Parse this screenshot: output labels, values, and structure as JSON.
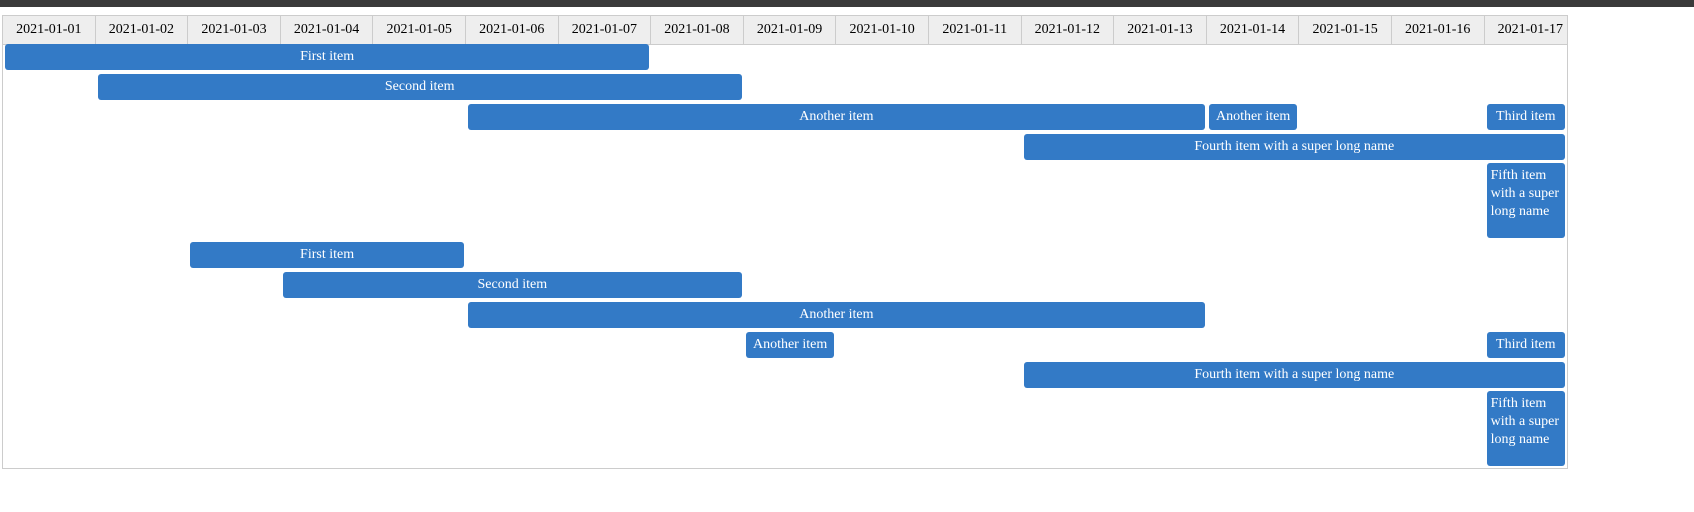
{
  "dates": [
    "2021-01-01",
    "2021-01-02",
    "2021-01-03",
    "2021-01-04",
    "2021-01-05",
    "2021-01-06",
    "2021-01-07",
    "2021-01-08",
    "2021-01-09",
    "2021-01-10",
    "2021-01-11",
    "2021-01-12",
    "2021-01-13",
    "2021-01-14",
    "2021-01-15",
    "2021-01-16",
    "2021-01-17"
  ],
  "items": [
    {
      "label": "First item",
      "start": "2021-01-01",
      "end": "2021-01-07",
      "row": 0
    },
    {
      "label": "Second item",
      "start": "2021-01-02",
      "end": "2021-01-08",
      "row": 1
    },
    {
      "label": "Another item",
      "start": "2021-01-06",
      "end": "2021-01-13",
      "row": 2
    },
    {
      "label": "Another item",
      "start": "2021-01-14",
      "end": "2021-01-14",
      "row": 2
    },
    {
      "label": "Third item",
      "start": "2021-01-17",
      "end": "2021-01-17",
      "row": 2
    },
    {
      "label": "Fourth item with a super long name",
      "start": "2021-01-12",
      "end": "2021-01-17",
      "row": 3
    },
    {
      "label": "Fifth item with a super long name",
      "start": "2021-01-17",
      "end": "2021-01-17",
      "row": 4
    },
    {
      "label": "First item",
      "start": "2021-01-03",
      "end": "2021-01-05",
      "row": 5
    },
    {
      "label": "Second item",
      "start": "2021-01-04",
      "end": "2021-01-08",
      "row": 6
    },
    {
      "label": "Another item",
      "start": "2021-01-06",
      "end": "2021-01-13",
      "row": 7
    },
    {
      "label": "Another item",
      "start": "2021-01-09",
      "end": "2021-01-09",
      "row": 8
    },
    {
      "label": "Third item",
      "start": "2021-01-17",
      "end": "2021-01-17",
      "row": 8
    },
    {
      "label": "Fourth item with a super long name",
      "start": "2021-01-12",
      "end": "2021-01-17",
      "row": 9
    },
    {
      "label": "Fifth item with a super long name",
      "start": "2021-01-17",
      "end": "2021-01-17",
      "row": 10
    }
  ]
}
